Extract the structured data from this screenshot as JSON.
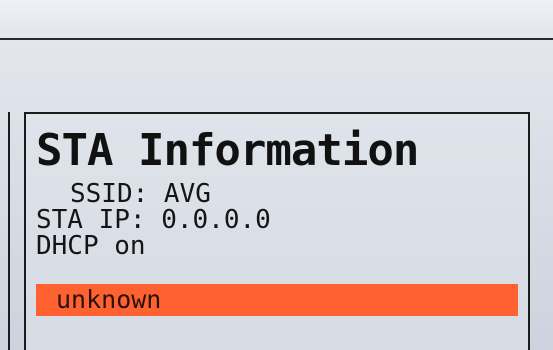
{
  "panel": {
    "title": "STA Information",
    "ssid_line": "SSID: AVG",
    "sta_ip_line": "STA IP: 0.0.0.0",
    "dhcp_line": "DHCP on",
    "status": "unknown"
  },
  "colors": {
    "status_bar": "#ff6130",
    "text": "#111111",
    "background": "#d9dee6"
  }
}
